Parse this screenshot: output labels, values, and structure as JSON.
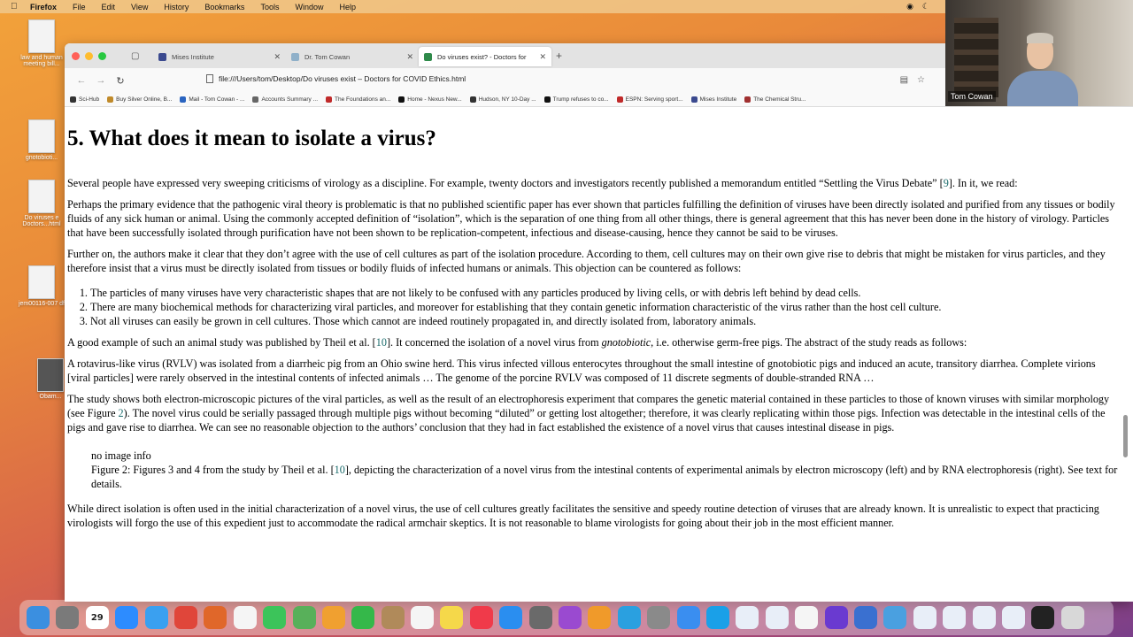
{
  "menubar": {
    "app": "Firefox",
    "items": [
      "File",
      "Edit",
      "View",
      "History",
      "Bookmarks",
      "Tools",
      "Window",
      "Help"
    ]
  },
  "desktop": {
    "icons": [
      {
        "label": "law and human meeting bill..."
      },
      {
        "label": "gnotobioti..."
      },
      {
        "label": "Do viruses e Doctors...html"
      },
      {
        "label": "jem00116-007 df"
      },
      {
        "label": "Obam..."
      }
    ]
  },
  "tabs": [
    {
      "label": "Mises Institute",
      "color": "#3b4a8f"
    },
    {
      "label": "Dr. Tom Cowan",
      "color": "#8fb0c9"
    },
    {
      "label": "Do viruses exist? - Doctors for",
      "color": "#2f8a4a"
    }
  ],
  "url": "file:///Users/tom/Desktop/Do viruses exist – Doctors for COVID Ethics.html",
  "bookmarks": [
    {
      "label": "Sci-Hub",
      "color": "#333"
    },
    {
      "label": "Buy Silver Online, B...",
      "color": "#c08a2a"
    },
    {
      "label": "Mail - Tom Cowan - ...",
      "color": "#2a64c0"
    },
    {
      "label": "Accounts Summary ...",
      "color": "#666"
    },
    {
      "label": "The Foundations an...",
      "color": "#c02a2a"
    },
    {
      "label": "Home - Nexus New...",
      "color": "#111"
    },
    {
      "label": "Hudson, NY 10-Day ...",
      "color": "#333"
    },
    {
      "label": "Trump refuses to co...",
      "color": "#111"
    },
    {
      "label": "ESPN: Serving sport...",
      "color": "#c02a2a"
    },
    {
      "label": "Mises Institute",
      "color": "#3b4a8f"
    },
    {
      "label": "The Chemical Stru...",
      "color": "#a03030"
    }
  ],
  "article": {
    "heading": "5. What does it mean to isolate a virus?",
    "p1_a": "Several people have expressed very sweeping criticisms of virology as a discipline. For example, twenty doctors and investigators recently published a memorandum entitled “Settling the Virus Debate” [",
    "p1_ref": "9",
    "p1_b": "]. In it, we read:",
    "quote1": "Perhaps the primary evidence that the pathogenic viral theory is problematic is that no published scientific paper has ever shown that particles fulfilling the definition of viruses have been directly isolated and purified from any tissues or bodily fluids of any sick human or animal. Using the commonly accepted definition of “isolation”, which is the separation of one thing from all other things, there is general agreement that this has never been done in the history of virology. Particles that have been successfully isolated through purification have not been shown to be replication-competent, infectious and disease-causing, hence they cannot be said to be viruses.",
    "p2": "Further on, the authors make it clear that they don’t agree with the use of cell cultures as part of the isolation procedure. According to them, cell cultures may on their own give rise to debris that might be mistaken for virus particles, and they therefore insist that a virus must be directly isolated from tissues or bodily fluids of infected humans or animals. This objection can be countered as follows:",
    "list": [
      "The particles of many viruses have very characteristic shapes that are not likely to be confused with any particles produced by living cells, or with debris left behind by dead cells.",
      "There are many biochemical methods for characterizing viral particles, and moreover for establishing that they contain genetic information characteristic of the virus rather than the host cell culture.",
      "Not all viruses can easily be grown in cell cultures. Those which cannot are indeed routinely propagated in, and directly isolated from, laboratory animals."
    ],
    "p3_a": "A good example of such an animal study was published by Theil et al. [",
    "p3_ref": "10",
    "p3_b": "]. It concerned the isolation of a novel virus from ",
    "p3_em": "gnotobiotic",
    "p3_c": ", i.e. otherwise germ-free pigs. The abstract of the study reads as follows:",
    "quote2": "A rotavirus-like virus (RVLV) was isolated from a diarrheic pig from an Ohio swine herd. This virus infected villous enterocytes throughout the small intestine of gnotobiotic pigs and induced an acute, transitory diarrhea. Complete virions [viral particles] were rarely observed in the intestinal contents of infected animals … The genome of the porcine RVLV was composed of 11 discrete segments of double-stranded RNA …",
    "p4_a": "The study shows both electron-microscopic pictures of the viral particles, as well as the result of an electrophoresis experiment that compares the genetic material contained in these particles to those of known viruses with similar morphology (see Figure ",
    "p4_ref": "2",
    "p4_b": "). The novel virus could be serially passaged through multiple pigs without becoming “diluted” or getting lost altogether; therefore, it was clearly replicating within those pigs. Infection was detectable in the intestinal cells of the pigs and gave rise to diarrhea. We can see no reasonable objection to the authors’ conclusion that they had in fact established the existence of a novel virus that causes intestinal disease in pigs.",
    "fig_noimg": "no image info",
    "fig_a": "Figure 2: Figures 3 and 4 from the study by Theil et al. [",
    "fig_ref": "10",
    "fig_b": "], depicting the characterization of a novel virus from the intestinal contents of experimental animals by electron microscopy (left) and by RNA electrophoresis (right). See text for details.",
    "p5": "While direct isolation is often used in the initial characterization of a novel virus, the use of cell cultures greatly facilitates the sensitive and speedy routine detection of viruses that are already known. It is unrealistic to expect that practicing virologists will forgo the use of this expedient just to accommodate the radical armchair skeptics. It is not reasonable to blame virologists for going about their job in the most efficient manner."
  },
  "webcam": {
    "name": "Tom Cowan"
  },
  "dock": {
    "calendar_day": "29",
    "apps": [
      {
        "icon": "finder-icon",
        "color": "#3b8fe0"
      },
      {
        "icon": "launchpad-icon",
        "color": "#7a7a7a"
      },
      {
        "icon": "calendar-icon",
        "color": "#ffffff"
      },
      {
        "icon": "zoom-icon",
        "color": "#2d8cff"
      },
      {
        "icon": "safari-icon",
        "color": "#3aa0f0"
      },
      {
        "icon": "chrome-icon",
        "color": "#e0463a"
      },
      {
        "icon": "firefox-icon",
        "color": "#e0672a"
      },
      {
        "icon": "textedit-icon",
        "color": "#f5f5f5"
      },
      {
        "icon": "messages-icon",
        "color": "#3cc45a"
      },
      {
        "icon": "maps-icon",
        "color": "#58b05a"
      },
      {
        "icon": "photos-icon",
        "color": "#f0a030"
      },
      {
        "icon": "facetime-icon",
        "color": "#35b84a"
      },
      {
        "icon": "contacts-icon",
        "color": "#b08a5a"
      },
      {
        "icon": "reminders-icon",
        "color": "#f5f5f5"
      },
      {
        "icon": "notes-icon",
        "color": "#f5d84a"
      },
      {
        "icon": "news-icon",
        "color": "#f03a4a"
      },
      {
        "icon": "appstore-icon",
        "color": "#2a8ef0"
      },
      {
        "icon": "settings-icon",
        "color": "#6a6a6a"
      },
      {
        "icon": "podcasts-icon",
        "color": "#9a4ad0"
      },
      {
        "icon": "pages-icon",
        "color": "#f09a2a"
      },
      {
        "icon": "telegram-icon",
        "color": "#2aa0e0"
      },
      {
        "icon": "preview-icon",
        "color": "#8a8a8a"
      },
      {
        "icon": "mail-icon",
        "color": "#3a8ef0"
      },
      {
        "icon": "skype-icon",
        "color": "#1aa0e8"
      },
      {
        "icon": "document-icon",
        "color": "#e8eef8"
      },
      {
        "icon": "document-icon",
        "color": "#e8eef8"
      },
      {
        "icon": "document-icon",
        "color": "#f5f5f5"
      },
      {
        "icon": "firefox-icon",
        "color": "#6a3ad0"
      },
      {
        "icon": "globe-icon",
        "color": "#3a70d0"
      },
      {
        "icon": "folder-icon",
        "color": "#4aa0e0"
      },
      {
        "icon": "document-icon",
        "color": "#e8eef8"
      },
      {
        "icon": "document-icon",
        "color": "#e8eef8"
      },
      {
        "icon": "document-icon",
        "color": "#e8eef8"
      },
      {
        "icon": "document-icon",
        "color": "#e8eef8"
      },
      {
        "icon": "terminal-icon",
        "color": "#222222"
      },
      {
        "icon": "trash-icon",
        "color": "#d8d8d8"
      }
    ]
  }
}
